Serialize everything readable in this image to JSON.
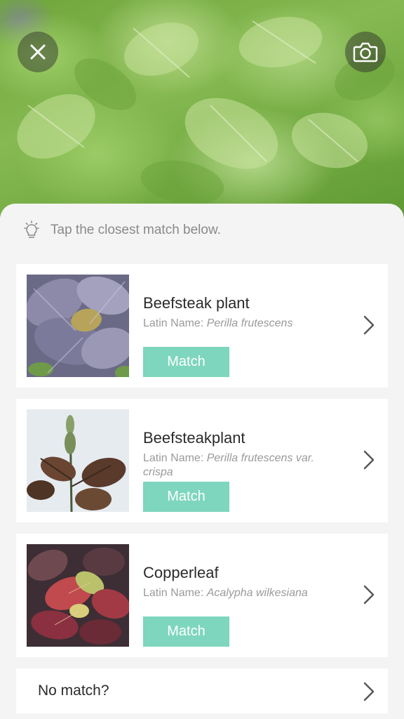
{
  "icons": {
    "close": "close-icon",
    "camera": "camera-icon",
    "hint": "lightbulb-icon",
    "chevron": "chevron-right-icon"
  },
  "colors": {
    "match_button": "#7dd6bd",
    "sheet_background": "#f4f4f4",
    "card_background": "#ffffff"
  },
  "hint": {
    "text": "Tap the closest match below."
  },
  "latin_prefix": "Latin Name:",
  "results": [
    {
      "name": "Beefsteak plant",
      "latin": "Perilla frutescens",
      "match_label": "Match"
    },
    {
      "name": "Beefsteakplant",
      "latin": "Perilla frutescens var. crispa",
      "match_label": "Match"
    },
    {
      "name": "Copperleaf",
      "latin": "Acalypha wilkesiana",
      "match_label": "Match"
    }
  ],
  "no_match": {
    "label": "No match?"
  }
}
